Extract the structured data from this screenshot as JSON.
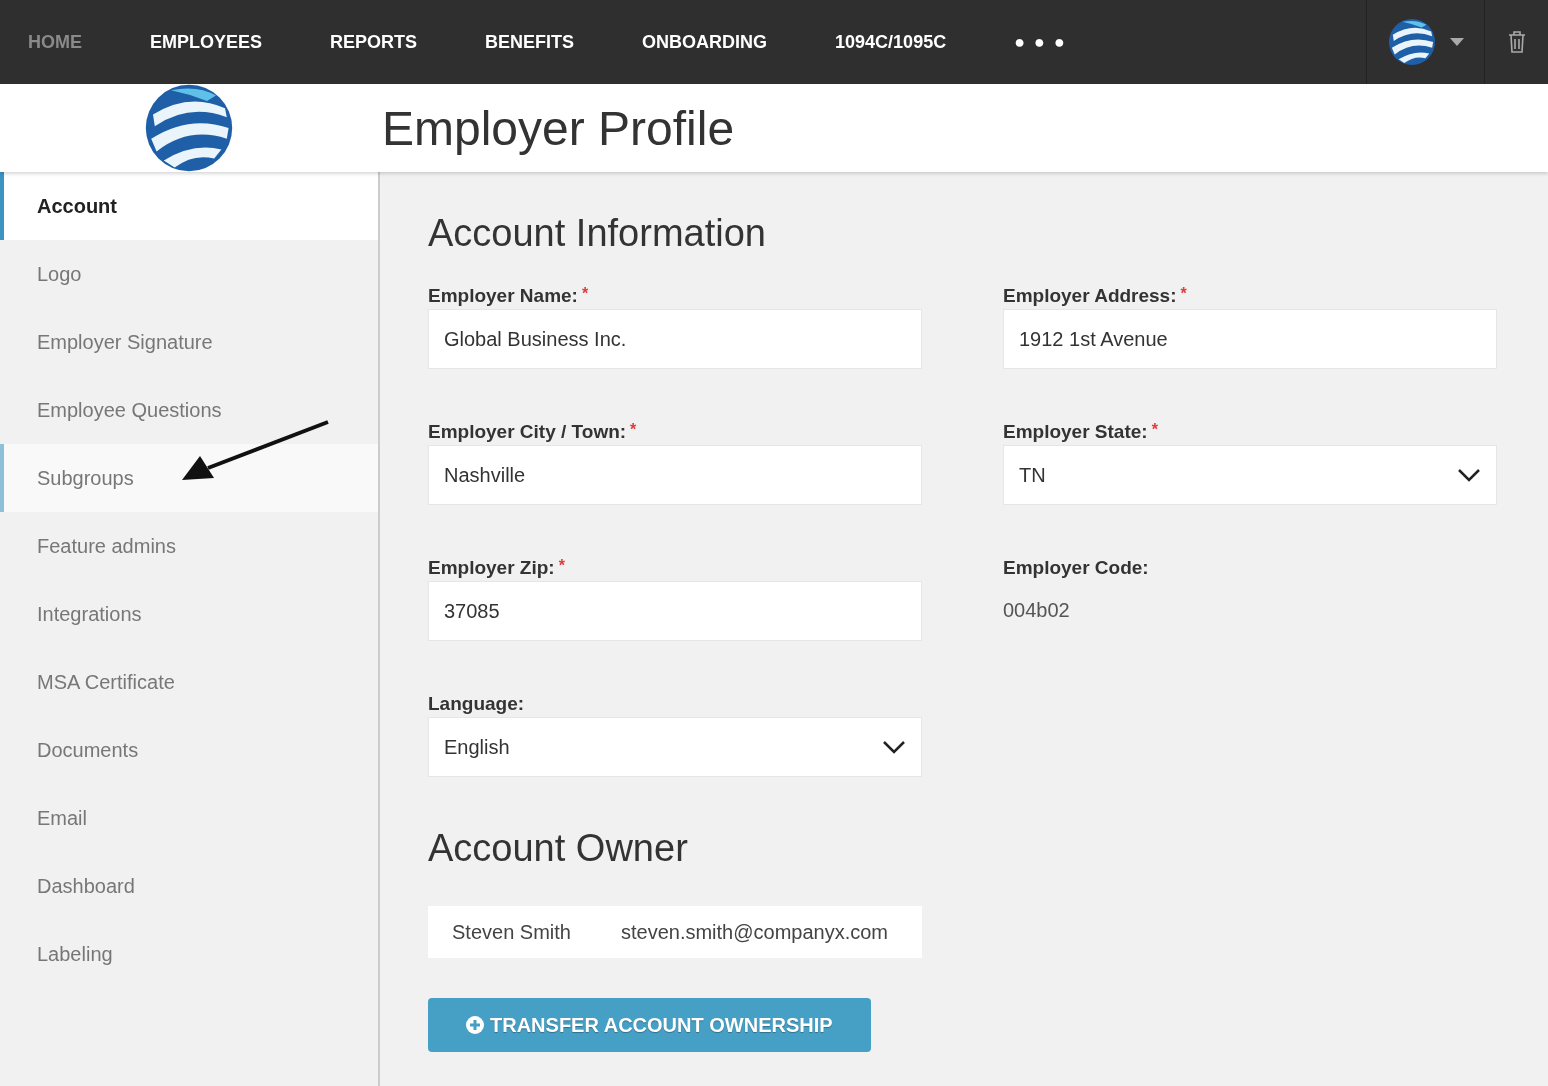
{
  "nav": {
    "items": [
      {
        "label": "HOME",
        "selected": true
      },
      {
        "label": "EMPLOYEES",
        "selected": false
      },
      {
        "label": "REPORTS",
        "selected": false
      },
      {
        "label": "BENEFITS",
        "selected": false
      },
      {
        "label": "ONBOARDING",
        "selected": false
      },
      {
        "label": "1094C/1095C",
        "selected": false
      }
    ],
    "more": "● ● ●"
  },
  "header": {
    "title": "Employer Profile"
  },
  "sidebar": {
    "items": [
      {
        "label": "Account",
        "selected": true,
        "hovered": false
      },
      {
        "label": "Logo",
        "selected": false,
        "hovered": false
      },
      {
        "label": "Employer Signature",
        "selected": false,
        "hovered": false
      },
      {
        "label": "Employee Questions",
        "selected": false,
        "hovered": false
      },
      {
        "label": "Subgroups",
        "selected": false,
        "hovered": true
      },
      {
        "label": "Feature admins",
        "selected": false,
        "hovered": false
      },
      {
        "label": "Integrations",
        "selected": false,
        "hovered": false
      },
      {
        "label": "MSA Certificate",
        "selected": false,
        "hovered": false
      },
      {
        "label": "Documents",
        "selected": false,
        "hovered": false
      },
      {
        "label": "Email",
        "selected": false,
        "hovered": false
      },
      {
        "label": "Dashboard",
        "selected": false,
        "hovered": false
      },
      {
        "label": "Labeling",
        "selected": false,
        "hovered": false
      }
    ],
    "annotation_arrow": true
  },
  "account_information": {
    "heading": "Account Information",
    "fields": [
      {
        "kind": "text",
        "label": "Employer Name:",
        "required_mark": "*",
        "value": "Global Business Inc."
      },
      {
        "kind": "text",
        "label": "Employer Address:",
        "required_mark": "*",
        "value": "1912 1st Avenue"
      },
      {
        "kind": "text",
        "label": "Employer City / Town:",
        "required_mark": "*",
        "value": "Nashville"
      },
      {
        "kind": "select",
        "label": "Employer State:",
        "required_mark": "*",
        "value": "TN"
      },
      {
        "kind": "text",
        "label": "Employer Zip:",
        "required_mark": "*",
        "value": "37085"
      },
      {
        "kind": "static",
        "label": "Employer Code:",
        "value": "004b02"
      },
      {
        "kind": "select",
        "label": "Language:",
        "value": "English"
      }
    ]
  },
  "account_owner": {
    "heading": "Account Owner",
    "name": "Steven Smith",
    "email": "steven.smith@companyx.com",
    "button": "TRANSFER ACCOUNT OWNERSHIP"
  }
}
